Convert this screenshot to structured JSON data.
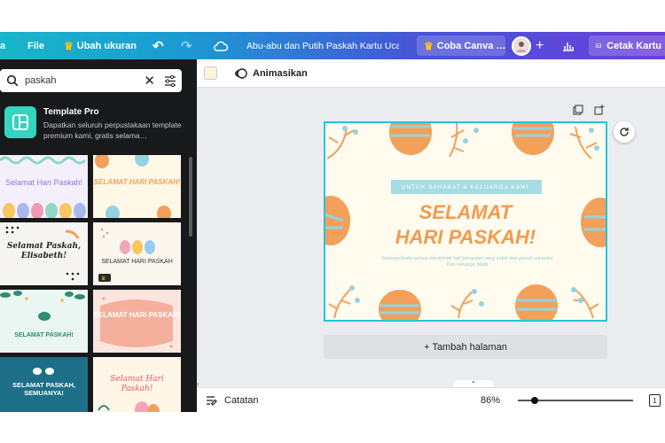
{
  "topbar": {
    "file_label": "File",
    "resize_label": "Ubah ukuran",
    "doc_title": "Abu-abu dan Putih Paskah Kartu Ucapan",
    "try_pro_label": "Coba Canva …",
    "print_label": "Cetak Kartu"
  },
  "left_panel": {
    "search_value": "paskah",
    "promo_title": "Template Pro",
    "promo_desc": "Dapatkan seluruh perpustakaan template premium kami, gratis selama…",
    "templates": [
      {
        "title": "Selamat Hari Paskah!"
      },
      {
        "title": "SELAMAT HARI PASKAH!"
      },
      {
        "title": "Selamat Paskah, Elisabeth!"
      },
      {
        "title": "SELAMAT HARI PASKAH"
      },
      {
        "title": "SELAMAT PASKAH!"
      },
      {
        "title": "SELAMAT HARI PASKAH!"
      },
      {
        "title": "SELAMAT PASKAH, SEMUANYA!"
      },
      {
        "title": "Selamat Hari Paskah!"
      }
    ]
  },
  "toolbar": {
    "animate_label": "Animasikan",
    "swatch_color": "#fdf3dc"
  },
  "card": {
    "ribbon_text": "UNTUK SAHABAT & KELUARGA KAMI:",
    "line1": "SELAMAT",
    "line2": "HARI PASKAH!",
    "subtext": "Semoga Anda semua menikmati hari perayaan yang indah dan penuh sukacita! Dari keluarga Malik"
  },
  "add_page_label": "+ Tambah halaman",
  "bottombar": {
    "notes_label": "Catatan",
    "zoom": "86%",
    "page_number": "1"
  },
  "colors": {
    "accent_teal": "#1fc7d8",
    "egg_orange": "#f2a05a",
    "egg_blue": "#95d3df"
  }
}
